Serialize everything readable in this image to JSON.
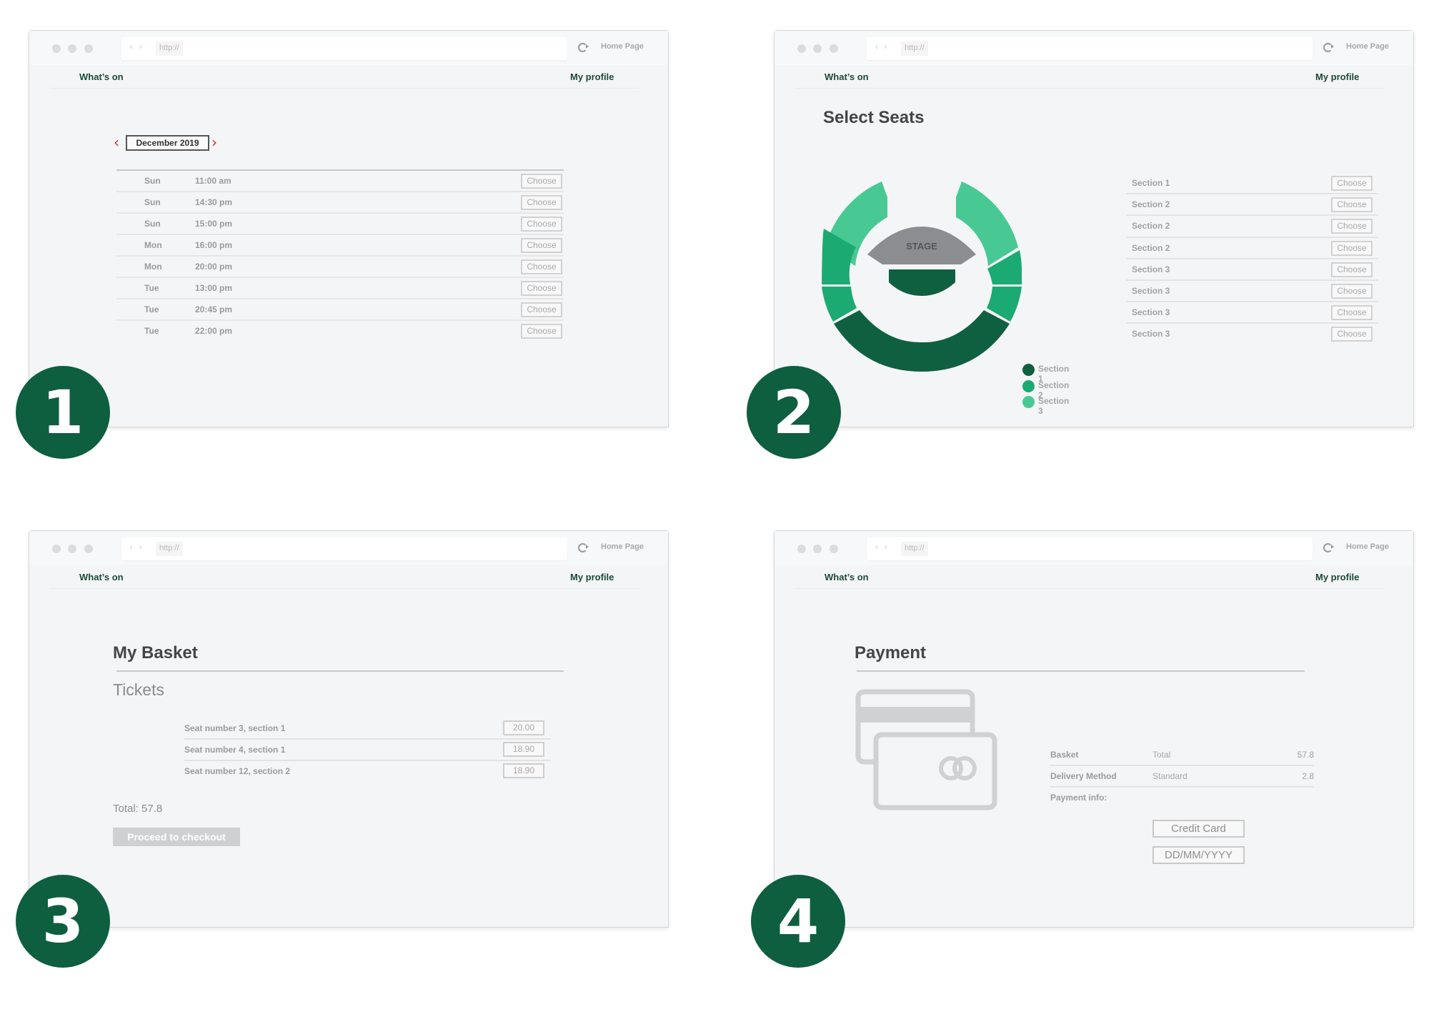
{
  "browser": {
    "url": "http://",
    "nav_arrows": "‹ ›",
    "home_link": "Home Page",
    "nav_left": "What’s on",
    "nav_right": "My profile"
  },
  "colors": {
    "brand_green": "#0e5e40",
    "section_1": "#0f6040",
    "section_2": "#1aaa72",
    "section_3": "#48c994",
    "stage": "#8c8d91",
    "calendar_arrow": "#c0392b"
  },
  "steps": [
    {
      "number": "1"
    },
    {
      "number": "2"
    },
    {
      "number": "3"
    },
    {
      "number": "4"
    }
  ],
  "showtimes": {
    "month": "December 2019",
    "prev_icon": "‹",
    "next_icon": "›",
    "choose_label": "Choose",
    "rows": [
      {
        "day": "Sun",
        "time": "11:00 am"
      },
      {
        "day": "Sun",
        "time": "14:30 pm"
      },
      {
        "day": "Sun",
        "time": "15:00 pm"
      },
      {
        "day": "Mon",
        "time": "16:00 pm"
      },
      {
        "day": "Mon",
        "time": "20:00 pm"
      },
      {
        "day": "Tue",
        "time": "13:00 pm"
      },
      {
        "day": "Tue",
        "time": "20:45 pm"
      },
      {
        "day": "Tue",
        "time": "22:00 pm"
      }
    ]
  },
  "seats": {
    "title": "Select Seats",
    "stage_label": "STAGE",
    "choose_label": "Choose",
    "legend": [
      {
        "label": "Section 1",
        "color": "#0f6040"
      },
      {
        "label": "Section 2",
        "color": "#1aaa72"
      },
      {
        "label": "Section 3",
        "color": "#48c994"
      }
    ],
    "sections": [
      "Section 1",
      "Section 2",
      "Section 2",
      "Section 2",
      "Section 3",
      "Section 3",
      "Section 3",
      "Section 3"
    ]
  },
  "basket": {
    "title": "My Basket",
    "subtitle": "Tickets",
    "items": [
      {
        "label": "Seat number 3, section 1",
        "price": "20.00"
      },
      {
        "label": "Seat number 4, section 1",
        "price": "18.90"
      },
      {
        "label": "Seat number 12, section 2",
        "price": "18.90"
      }
    ],
    "total": "Total: 57.8",
    "checkout_label": "Proceed to checkout"
  },
  "payment": {
    "title": "Payment",
    "rows": [
      {
        "label": "Basket",
        "mid": "Total",
        "value": "57.8"
      },
      {
        "label": "Delivery Method",
        "mid": "Standard",
        "value": "2.8"
      }
    ],
    "info_label": "Payment info:",
    "card_placeholder": "Credit Card",
    "date_placeholder": "DD/MM/YYYY"
  }
}
